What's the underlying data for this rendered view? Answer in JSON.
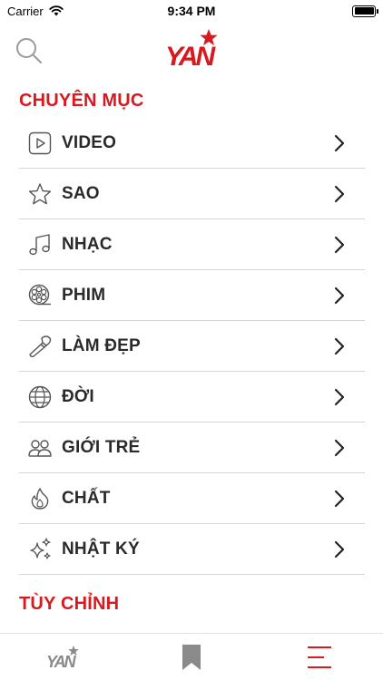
{
  "status_bar": {
    "carrier": "Carrier",
    "time": "9:34 PM"
  },
  "header": {
    "logo_text": "YAN",
    "search_icon": "search-icon"
  },
  "sections": {
    "categories_title": "CHUYÊN MỤC",
    "customize_title": "TÙY CHỈNH"
  },
  "menu": [
    {
      "label": "VIDEO",
      "icon": "video-play-icon"
    },
    {
      "label": "SAO",
      "icon": "star-icon"
    },
    {
      "label": "NHẠC",
      "icon": "music-note-icon"
    },
    {
      "label": "PHIM",
      "icon": "film-reel-icon"
    },
    {
      "label": "LÀM ĐẸP",
      "icon": "makeup-brush-icon"
    },
    {
      "label": "ĐỜI",
      "icon": "globe-icon"
    },
    {
      "label": "GIỚI TRẺ",
      "icon": "people-icon"
    },
    {
      "label": "CHẤT",
      "icon": "flame-icon"
    },
    {
      "label": "NHẬT KÝ",
      "icon": "sparkles-icon"
    }
  ],
  "tab_bar": [
    {
      "icon": "yan-logo-icon",
      "active": false
    },
    {
      "icon": "bookmark-icon",
      "active": false
    },
    {
      "icon": "menu-icon",
      "active": true
    }
  ],
  "colors": {
    "accent": "#d71920",
    "text": "#2a2a2a",
    "divider": "#d6d6d6",
    "icon_gray": "#555555",
    "tab_gray": "#8a8a8a"
  }
}
